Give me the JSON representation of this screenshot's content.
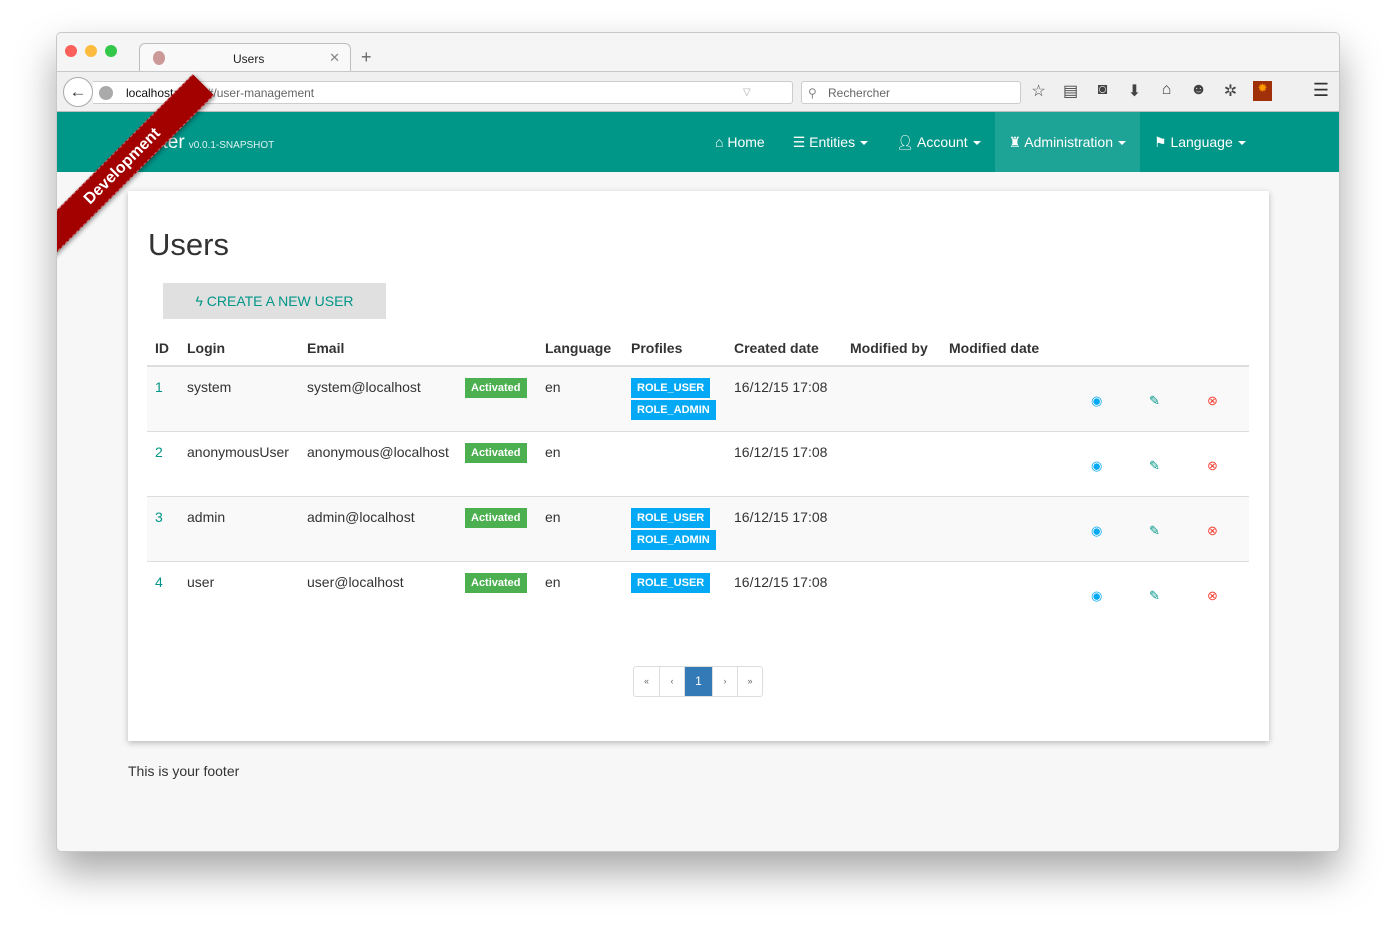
{
  "browser": {
    "tab_title": "Users",
    "url_host": "localhost",
    "url_rest": ":8080/#/user-management",
    "search_placeholder": "Rechercher"
  },
  "navbar": {
    "brand": "ster",
    "version": "v0.0.1-SNAPSHOT",
    "ribbon": "Development",
    "items": [
      {
        "label": "Home",
        "icon": "home-icon"
      },
      {
        "label": "Entities",
        "icon": "list-icon"
      },
      {
        "label": "Account",
        "icon": "user-icon"
      },
      {
        "label": "Administration",
        "icon": "tower-icon"
      },
      {
        "label": "Language",
        "icon": "flag-icon"
      }
    ]
  },
  "page": {
    "title": "Users",
    "create_label": "CREATE A NEW USER"
  },
  "table": {
    "headers": [
      "ID",
      "Login",
      "Email",
      "Language",
      "Profiles",
      "Created date",
      "Modified by",
      "Modified date"
    ],
    "rows": [
      {
        "id": "1",
        "login": "system",
        "email": "system@localhost",
        "status": "Activated",
        "lang": "en",
        "roles": [
          "ROLE_USER",
          "ROLE_ADMIN"
        ],
        "created": "16/12/15 17:08"
      },
      {
        "id": "2",
        "login": "anonymousUser",
        "email": "anonymous@localhost",
        "status": "Activated",
        "lang": "en",
        "roles": [],
        "created": "16/12/15 17:08"
      },
      {
        "id": "3",
        "login": "admin",
        "email": "admin@localhost",
        "status": "Activated",
        "lang": "en",
        "roles": [
          "ROLE_USER",
          "ROLE_ADMIN"
        ],
        "created": "16/12/15 17:08"
      },
      {
        "id": "4",
        "login": "user",
        "email": "user@localhost",
        "status": "Activated",
        "lang": "en",
        "roles": [
          "ROLE_USER"
        ],
        "created": "16/12/15 17:08"
      }
    ]
  },
  "pagination": {
    "first": "«",
    "prev": "‹",
    "current": "1",
    "next": "›",
    "last": "»"
  },
  "footer": "This is your footer",
  "colors": {
    "primary": "#009688",
    "activated": "#4caf50",
    "role": "#03a9f4",
    "delete": "#f44336",
    "ribbon": "#a30000"
  }
}
